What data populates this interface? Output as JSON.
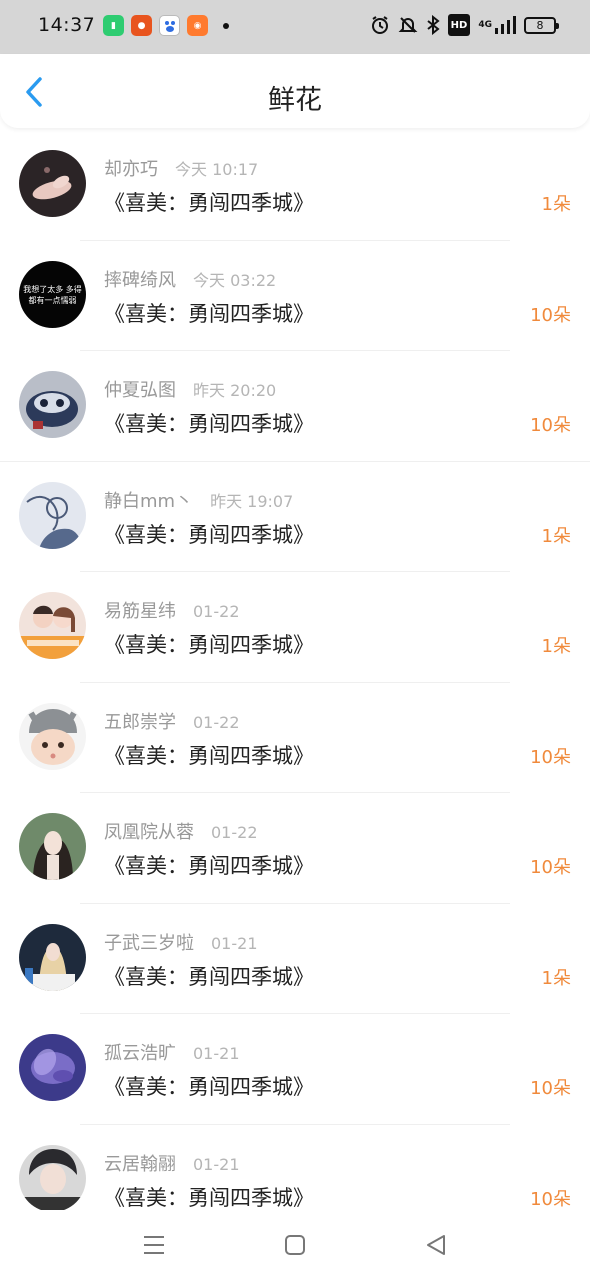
{
  "status_bar": {
    "time": "14:37",
    "apps": [
      "battery-saver-icon",
      "app-icon-2",
      "baidu-icon",
      "app-icon-4"
    ],
    "network_label": "4G",
    "hd_label": "HD",
    "battery_level": "8"
  },
  "header": {
    "title": "鲜花",
    "back_icon": "chevron-left-icon"
  },
  "accent_colors": {
    "back": "#2a9bf0",
    "count": "#f08a3c"
  },
  "records": [
    {
      "user": "却亦巧",
      "time": "今天 10:17",
      "gift": "《喜美：勇闯四季城》",
      "count": "1朵"
    },
    {
      "user": "摔碑绮风",
      "time": "今天 03:22",
      "gift": "《喜美：勇闯四季城》",
      "count": "10朵",
      "avatar_text": "我想了太多 多得都有一点懦弱"
    },
    {
      "user": "仲夏弘图",
      "time": "昨天 20:20",
      "gift": "《喜美：勇闯四季城》",
      "count": "10朵"
    },
    {
      "user": "静白mm丶",
      "time": "昨天 19:07",
      "gift": "《喜美：勇闯四季城》",
      "count": "1朵"
    },
    {
      "user": "易筋星纬",
      "time": "01-22",
      "gift": "《喜美：勇闯四季城》",
      "count": "1朵"
    },
    {
      "user": "五郎崇学",
      "time": "01-22",
      "gift": "《喜美：勇闯四季城》",
      "count": "10朵"
    },
    {
      "user": "凤凰院从蓉",
      "time": "01-22",
      "gift": "《喜美：勇闯四季城》",
      "count": "10朵"
    },
    {
      "user": "子武三岁啦",
      "time": "01-21",
      "gift": "《喜美：勇闯四季城》",
      "count": "1朵"
    },
    {
      "user": "孤云浩旷",
      "time": "01-21",
      "gift": "《喜美：勇闯四季城》",
      "count": "10朵"
    },
    {
      "user": "云居翰翮",
      "time": "01-21",
      "gift": "《喜美：勇闯四季城》",
      "count": "10朵"
    }
  ],
  "nav_bar": {
    "menu_icon": "menu-icon",
    "home_icon": "home-square-icon",
    "back_icon": "back-triangle-icon"
  }
}
